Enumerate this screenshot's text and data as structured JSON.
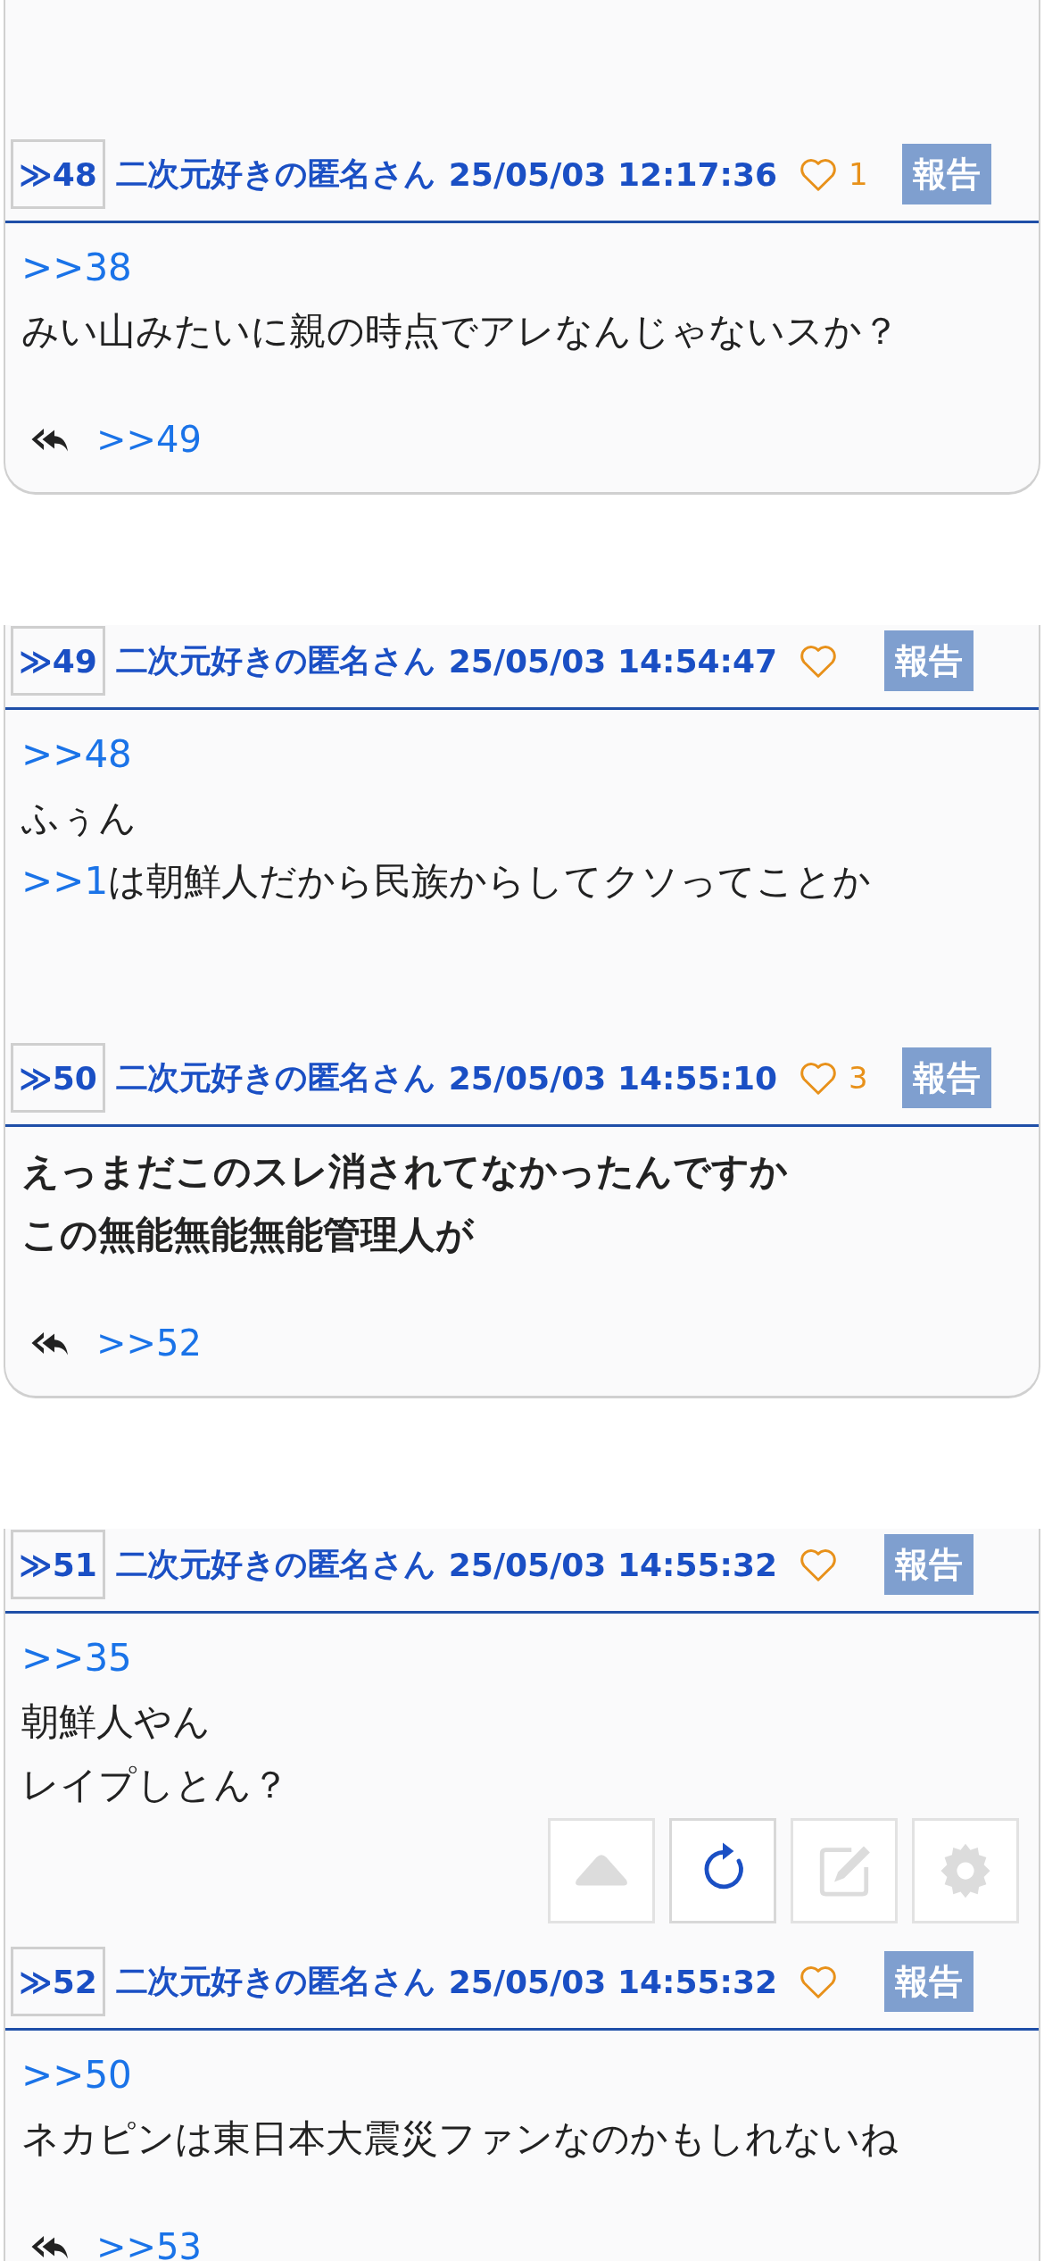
{
  "posts": [
    {
      "number": "≫48",
      "author": "二次元好きの匿名さん",
      "date": "25/05/03 12:17:36",
      "likes": "1",
      "report": "報告",
      "bold": false,
      "lines": [
        [
          {
            "kind": "anchor",
            "text": ">>38"
          }
        ],
        [
          {
            "kind": "text",
            "text": "みい山みたいに親の時点でアレなんじゃないスか？"
          }
        ]
      ],
      "replies": [
        ">>49"
      ]
    },
    {
      "number": "≫49",
      "author": "二次元好きの匿名さん",
      "date": "25/05/03 14:54:47",
      "report": "報告",
      "bold": false,
      "lines": [
        [
          {
            "kind": "anchor",
            "text": ">>48"
          }
        ],
        [
          {
            "kind": "text",
            "text": "ふぅん"
          }
        ],
        [
          {
            "kind": "anchor",
            "text": ">>1"
          },
          {
            "kind": "text",
            "text": "は朝鮮人だから民族からしてクソってことか"
          }
        ]
      ]
    },
    {
      "number": "≫50",
      "author": "二次元好きの匿名さん",
      "date": "25/05/03 14:55:10",
      "likes": "3",
      "report": "報告",
      "bold": true,
      "lines": [
        [
          {
            "kind": "text",
            "text": "えっまだこのスレ消されてなかったんですか"
          }
        ],
        [
          {
            "kind": "text",
            "text": "この無能無能無能管理人が"
          }
        ]
      ],
      "replies": [
        ">>52"
      ]
    },
    {
      "number": "≫51",
      "author": "二次元好きの匿名さん",
      "date": "25/05/03 14:55:32",
      "report": "報告",
      "bold": false,
      "lines": [
        [
          {
            "kind": "anchor",
            "text": ">>35"
          }
        ],
        [
          {
            "kind": "text",
            "text": "朝鮮人やん"
          }
        ],
        [
          {
            "kind": "text",
            "text": "レイプしとん？"
          }
        ]
      ]
    },
    {
      "number": "≫52",
      "author": "二次元好きの匿名さん",
      "date": "25/05/03 14:55:32",
      "report": "報告",
      "bold": false,
      "lines": [
        [
          {
            "kind": "anchor",
            "text": ">>50"
          }
        ],
        [
          {
            "kind": "text",
            "text": "ネカピンは東日本大震災ファンなのかもしれないね"
          }
        ]
      ],
      "replies": [
        ">>53"
      ]
    }
  ],
  "floating_buttons": [
    {
      "kind": "top",
      "disabled": true
    },
    {
      "kind": "reload",
      "disabled": false
    },
    {
      "kind": "edit",
      "disabled": true
    },
    {
      "kind": "settings",
      "disabled": true
    }
  ]
}
